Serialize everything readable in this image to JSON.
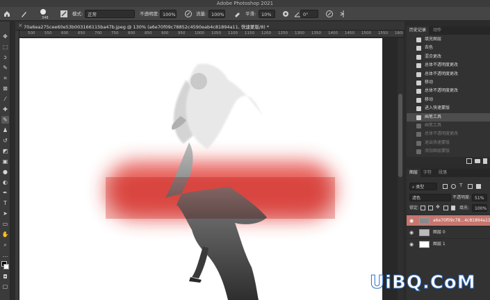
{
  "app": {
    "title": "Adobe Photoshop 2021"
  },
  "options_bar": {
    "brush_size": "348",
    "mode_label": "模式:",
    "mode_value": "正常",
    "opacity_label": "不透明度:",
    "opacity_value": "100%",
    "flow_label": "流量:",
    "flow_value": "100%",
    "smoothing_label": "平滑:",
    "smoothing_value": "10%",
    "angle_value": "0°"
  },
  "document": {
    "tab_title": "70a6ea275cee60e53b003166115ba47b.jpeg @ 130% (a6e70f09c78852c4590eab4c81894a11, 快速蒙版/8) *",
    "close_glyph": "×"
  },
  "ruler": {
    "ticks": [
      "500",
      "550",
      "600",
      "650",
      "700",
      "750",
      "800",
      "850",
      "900",
      "950",
      "1000",
      "1050",
      "1100",
      "1150",
      "1200",
      "1250",
      "1300",
      "1350",
      "1400",
      "1450",
      "1500",
      "1550",
      "1600"
    ]
  },
  "history_panel": {
    "tabs": [
      {
        "label": "历史记录",
        "active": true
      },
      {
        "label": "动作",
        "active": false
      }
    ],
    "items": [
      {
        "label": "填充图层",
        "state": "normal"
      },
      {
        "label": "去色",
        "state": "normal"
      },
      {
        "label": "混合更改",
        "state": "normal"
      },
      {
        "label": "总体不透明度更改",
        "state": "normal"
      },
      {
        "label": "总体不透明度更改",
        "state": "normal"
      },
      {
        "label": "移动",
        "state": "normal"
      },
      {
        "label": "总体不透明度更改",
        "state": "normal"
      },
      {
        "label": "移动",
        "state": "normal"
      },
      {
        "label": "进入快速蒙版",
        "state": "normal"
      },
      {
        "label": "画笔工具",
        "state": "active"
      },
      {
        "label": "画笔工具",
        "state": "dim"
      },
      {
        "label": "总体不透明度更改",
        "state": "dim"
      },
      {
        "label": "退出快速蒙版",
        "state": "dim"
      },
      {
        "label": "添加图层蒙版",
        "state": "dim"
      },
      {
        "label": "退出快速蒙版",
        "state": "dim"
      }
    ]
  },
  "layers_panel": {
    "tabs": [
      {
        "label": "图层",
        "active": true
      },
      {
        "label": "字符",
        "active": false
      },
      {
        "label": "段落",
        "active": false
      }
    ],
    "filter_label": "类型",
    "blend_mode": "滤色",
    "opacity_label": "不透明度:",
    "opacity_value": "51%",
    "lock_label": "锁定:",
    "fill_label": "填充:",
    "fill_value": "100%",
    "layers": [
      {
        "name": "a6e70f09c78...4c81894a11",
        "selected": true
      },
      {
        "name": "图层 0",
        "selected": false
      },
      {
        "name": "图层 1",
        "selected": false
      }
    ]
  },
  "watermark": {
    "main": "UiBQ.CoM",
    "suffix": ""
  },
  "colors": {
    "selected_layer": "#c7766e",
    "red_tint": "#d9302a",
    "watermark_blue": "#2b6cc9"
  }
}
